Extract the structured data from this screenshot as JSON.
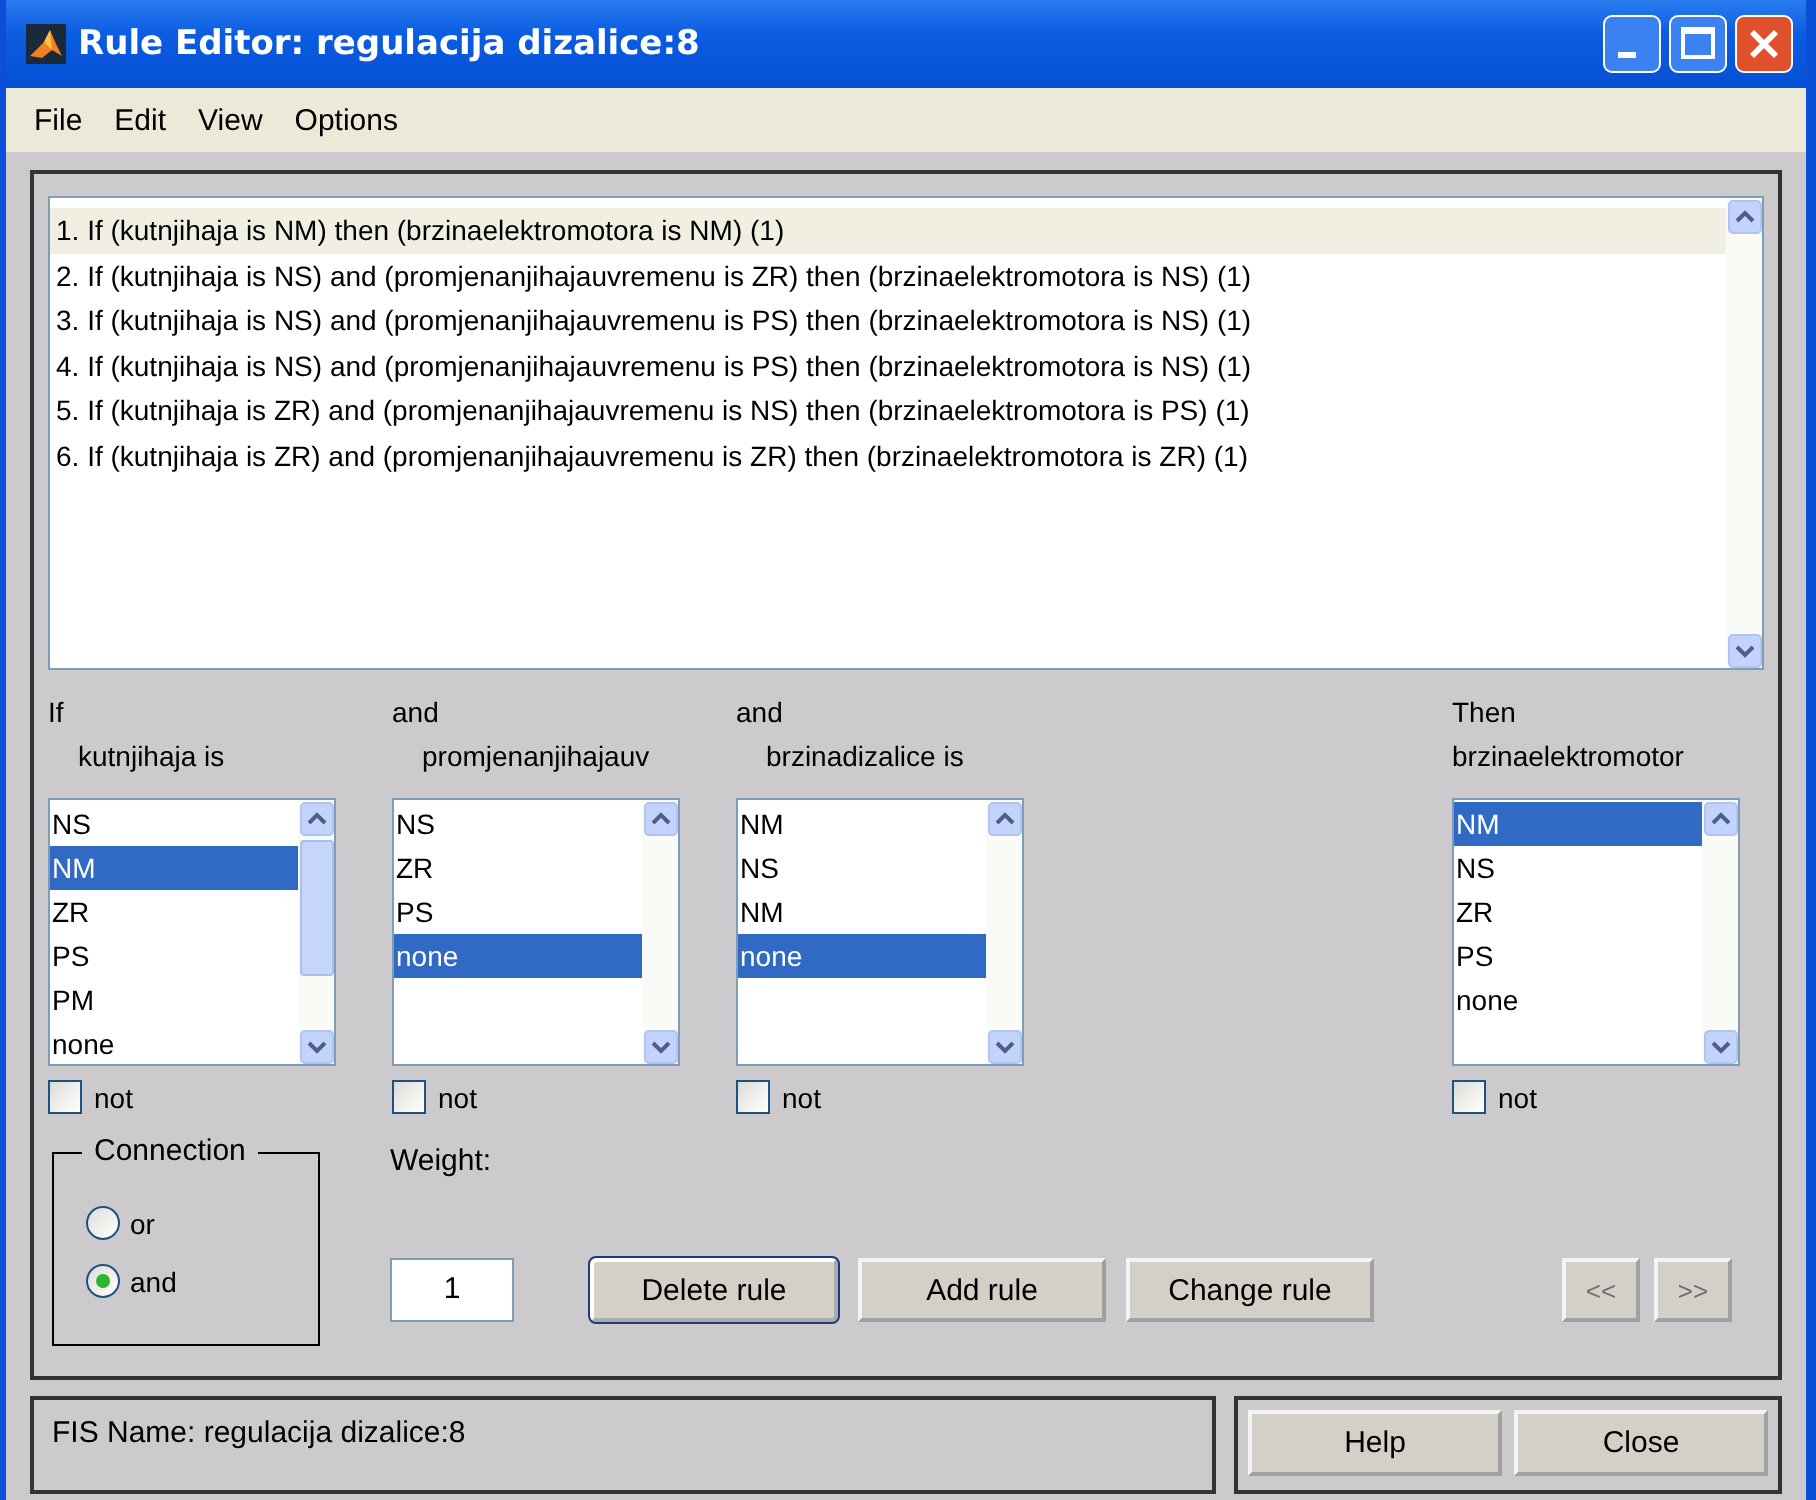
{
  "window": {
    "title": "Rule Editor: regulacija dizalice:8"
  },
  "menu": [
    {
      "label": "File"
    },
    {
      "label": "Edit"
    },
    {
      "label": "View"
    },
    {
      "label": "Options"
    }
  ],
  "rules": [
    {
      "text": "1. If (kutnjihaja is NM) then (brzinaelektromotora is NM) (1)",
      "selected": true
    },
    {
      "text": "2. If (kutnjihaja is NS) and (promjenanjihajauvremenu is ZR) then (brzinaelektromotora is NS) (1)",
      "selected": false
    },
    {
      "text": "3. If (kutnjihaja is NS) and (promjenanjihajauvremenu is PS) then (brzinaelektromotora is NS) (1)",
      "selected": false
    },
    {
      "text": "4. If (kutnjihaja is NS) and (promjenanjihajauvremenu is PS) then (brzinaelektromotora is NS) (1)",
      "selected": false
    },
    {
      "text": "5. If (kutnjihaja is ZR) and (promjenanjihajauvremenu is NS) then (brzinaelektromotora is PS) (1)",
      "selected": false
    },
    {
      "text": "6. If (kutnjihaja is ZR) and (promjenanjihajauvremenu is ZR) then (brzinaelektromotora is ZR) (1)",
      "selected": false
    }
  ],
  "variables": [
    {
      "kind": "antecedent",
      "connective": "If",
      "name": "kutnjihaja is",
      "not_label": "not",
      "not": false,
      "items": [
        {
          "label": "NS",
          "selected": false
        },
        {
          "label": "NM",
          "selected": true
        },
        {
          "label": "ZR",
          "selected": false
        },
        {
          "label": "PS",
          "selected": false
        },
        {
          "label": "PM",
          "selected": false
        },
        {
          "label": "none",
          "selected": false
        }
      ]
    },
    {
      "kind": "antecedent",
      "connective": "and",
      "name": "promjenanjihajauv",
      "not_label": "not",
      "not": false,
      "items": [
        {
          "label": "NS",
          "selected": false
        },
        {
          "label": "ZR",
          "selected": false
        },
        {
          "label": "PS",
          "selected": false
        },
        {
          "label": "none",
          "selected": true
        }
      ]
    },
    {
      "kind": "antecedent",
      "connective": "and",
      "name": "brzinadizalice is",
      "not_label": "not",
      "not": false,
      "items": [
        {
          "label": "NM",
          "selected": false
        },
        {
          "label": "NS",
          "selected": false
        },
        {
          "label": "NM",
          "selected": false
        },
        {
          "label": "none",
          "selected": true
        }
      ]
    },
    {
      "kind": "consequent",
      "connective": "Then",
      "name": "brzinaelektromotor",
      "not_label": "not",
      "not": false,
      "items": [
        {
          "label": "NM",
          "selected": true
        },
        {
          "label": "NS",
          "selected": false
        },
        {
          "label": "ZR",
          "selected": false
        },
        {
          "label": "PS",
          "selected": false
        },
        {
          "label": "none",
          "selected": false
        }
      ]
    }
  ],
  "connection": {
    "label": "Connection",
    "options": [
      {
        "label": "or",
        "selected": false
      },
      {
        "label": "and",
        "selected": true
      }
    ]
  },
  "weight": {
    "label": "Weight:",
    "value": "1"
  },
  "actions": [
    {
      "label": "Delete rule",
      "focused": true
    },
    {
      "label": "Add rule",
      "focused": false
    },
    {
      "label": "Change rule",
      "focused": false
    }
  ],
  "navigation": [
    {
      "label": "<<",
      "disabled": true
    },
    {
      "label": ">>",
      "disabled": true
    }
  ],
  "status": "FIS Name: regulacija dizalice:8",
  "footer_buttons": [
    {
      "label": "Help"
    },
    {
      "label": "Close"
    }
  ]
}
